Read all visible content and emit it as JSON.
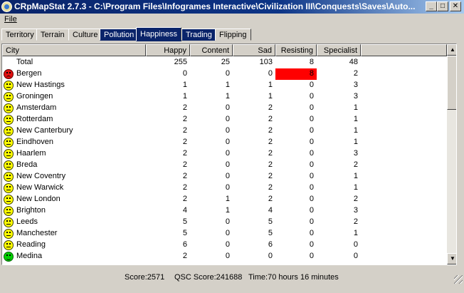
{
  "window": {
    "title": "CRpMapStat 2.7.3 - C:\\Program Files\\Infogrames Interactive\\Civilization III\\Conquests\\Saves\\Auto...",
    "minimize": "_",
    "maximize": "□",
    "close": "✕"
  },
  "menu": {
    "file": "File"
  },
  "tabs": [
    {
      "label": "Territory"
    },
    {
      "label": "Terrain"
    },
    {
      "label": "Culture"
    },
    {
      "label": "Pollution"
    },
    {
      "label": "Happiness"
    },
    {
      "label": "Trading"
    },
    {
      "label": "Flipping"
    }
  ],
  "columns": [
    "City",
    "Happy",
    "Content",
    "Sad",
    "Resisting",
    "Specialist"
  ],
  "total": {
    "label": "Total",
    "happy": "255",
    "content": "25",
    "sad": "103",
    "resisting": "8",
    "specialist": "48"
  },
  "rows": [
    {
      "icon": "unhappy-face-icon",
      "city": "Bergen",
      "happy": "0",
      "content": "0",
      "sad": "0",
      "resisting": "8",
      "specialist": "2"
    },
    {
      "icon": "neutral-face-icon",
      "city": "New Hastings",
      "happy": "1",
      "content": "1",
      "sad": "1",
      "resisting": "0",
      "specialist": "3"
    },
    {
      "icon": "neutral-face-icon",
      "city": "Groningen",
      "happy": "1",
      "content": "1",
      "sad": "1",
      "resisting": "0",
      "specialist": "3"
    },
    {
      "icon": "neutral-face-icon",
      "city": "Amsterdam",
      "happy": "2",
      "content": "0",
      "sad": "2",
      "resisting": "0",
      "specialist": "1"
    },
    {
      "icon": "neutral-face-icon",
      "city": "Rotterdam",
      "happy": "2",
      "content": "0",
      "sad": "2",
      "resisting": "0",
      "specialist": "1"
    },
    {
      "icon": "neutral-face-icon",
      "city": "New Canterbury",
      "happy": "2",
      "content": "0",
      "sad": "2",
      "resisting": "0",
      "specialist": "1"
    },
    {
      "icon": "neutral-face-icon",
      "city": "Eindhoven",
      "happy": "2",
      "content": "0",
      "sad": "2",
      "resisting": "0",
      "specialist": "1"
    },
    {
      "icon": "neutral-face-icon",
      "city": "Haarlem",
      "happy": "2",
      "content": "0",
      "sad": "2",
      "resisting": "0",
      "specialist": "3"
    },
    {
      "icon": "neutral-face-icon",
      "city": "Breda",
      "happy": "2",
      "content": "0",
      "sad": "2",
      "resisting": "0",
      "specialist": "2"
    },
    {
      "icon": "neutral-face-icon",
      "city": "New Coventry",
      "happy": "2",
      "content": "0",
      "sad": "2",
      "resisting": "0",
      "specialist": "1"
    },
    {
      "icon": "neutral-face-icon",
      "city": "New Warwick",
      "happy": "2",
      "content": "0",
      "sad": "2",
      "resisting": "0",
      "specialist": "1"
    },
    {
      "icon": "neutral-face-icon",
      "city": "New London",
      "happy": "2",
      "content": "1",
      "sad": "2",
      "resisting": "0",
      "specialist": "2"
    },
    {
      "icon": "neutral-face-icon",
      "city": "Brighton",
      "happy": "4",
      "content": "1",
      "sad": "4",
      "resisting": "0",
      "specialist": "3"
    },
    {
      "icon": "neutral-face-icon",
      "city": "Leeds",
      "happy": "5",
      "content": "0",
      "sad": "5",
      "resisting": "0",
      "specialist": "2"
    },
    {
      "icon": "neutral-face-icon",
      "city": "Manchester",
      "happy": "5",
      "content": "0",
      "sad": "5",
      "resisting": "0",
      "specialist": "1"
    },
    {
      "icon": "neutral-face-icon",
      "city": "Reading",
      "happy": "6",
      "content": "0",
      "sad": "6",
      "resisting": "0",
      "specialist": "0"
    },
    {
      "icon": "happy-face-icon",
      "city": "Medina",
      "happy": "2",
      "content": "0",
      "sad": "0",
      "resisting": "0",
      "specialist": "0"
    }
  ],
  "scrollbar": {
    "up": "▲",
    "down": "▼"
  },
  "status": {
    "score": "Score:2571",
    "qsc": "QSC Score:241688",
    "time": "Time:70 hours 16 minutes"
  },
  "colors": {
    "alert": "#ff0000",
    "tab_dark": "#0a246a",
    "titlebar": "#0a246a"
  }
}
